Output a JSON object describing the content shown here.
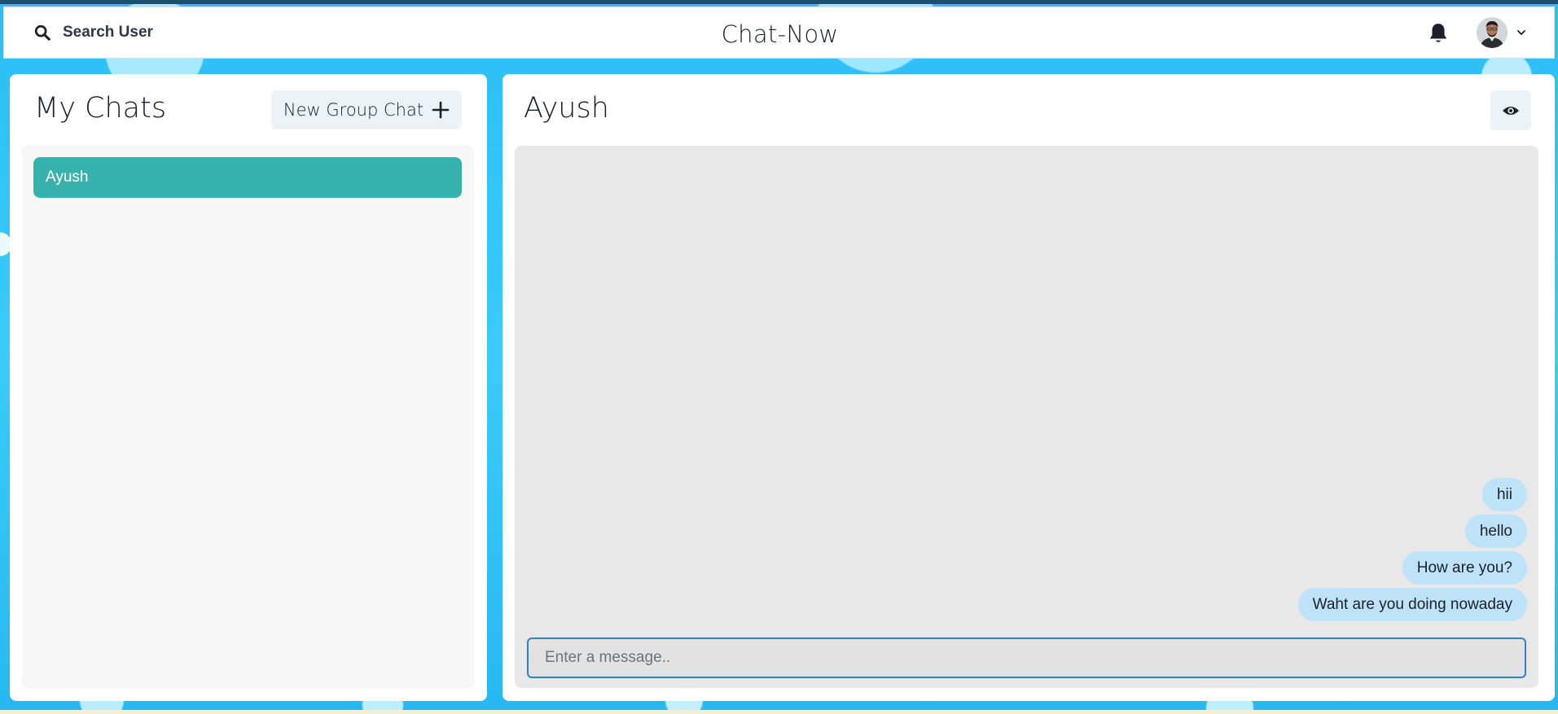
{
  "header": {
    "search_label": "Search User",
    "app_title": "Chat-Now"
  },
  "sidebar": {
    "title": "My Chats",
    "new_group_label": "New Group Chat",
    "chats": [
      {
        "name": "Ayush",
        "selected": true
      }
    ]
  },
  "chat": {
    "title": "Ayush",
    "messages": [
      {
        "text": "hii"
      },
      {
        "text": "hello"
      },
      {
        "text": "How are you?"
      },
      {
        "text": "Waht are you doing nowaday"
      }
    ],
    "input_placeholder": "Enter a message.."
  },
  "colors": {
    "accent": "#38b2ac",
    "bubble": "#bee3f8",
    "input_border": "#3182ce",
    "background": "#2fc3f7"
  },
  "icons": {
    "search": "search-icon",
    "bell": "bell-icon",
    "chevron": "chevron-down-icon",
    "plus": "plus-icon",
    "eye": "eye-icon"
  }
}
